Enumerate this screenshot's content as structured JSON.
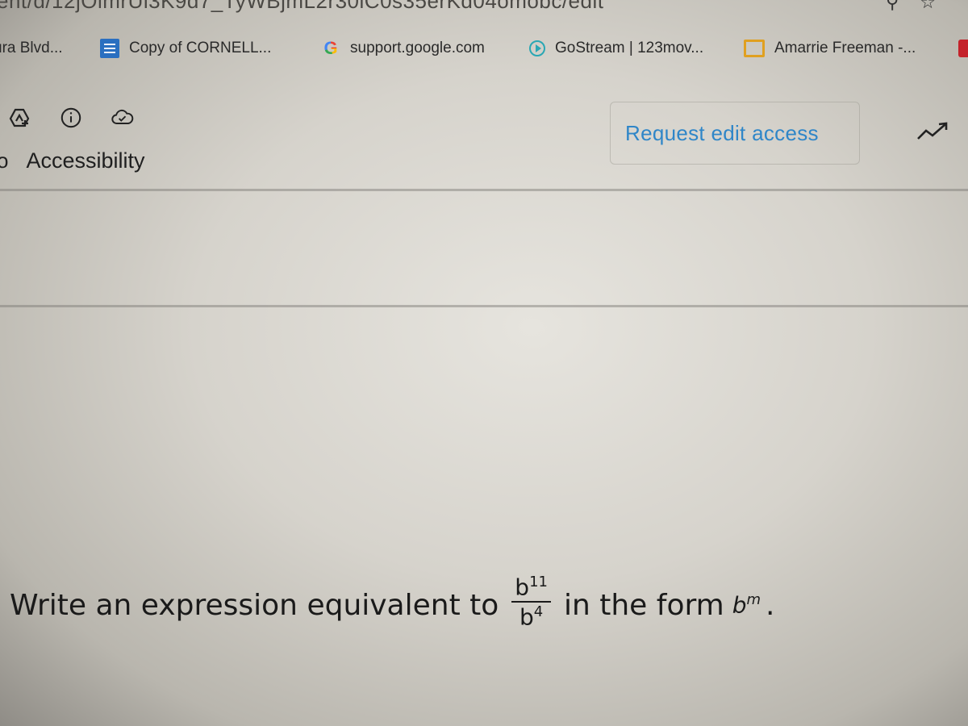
{
  "browser": {
    "url_fragment": "ent/d/12jOlmrUl3K9d7_TyWBjmL2r30lC0s35erKd04omobc/edit",
    "url_icons": [
      "zoom-icon",
      "star-icon"
    ]
  },
  "bookmarks": [
    {
      "label": "ura Blvd...",
      "icon": "none"
    },
    {
      "label": "Copy of CORNELL...",
      "icon": "docs-icon"
    },
    {
      "label": "support.google.com",
      "icon": "google-icon"
    },
    {
      "label": "GoStream | 123mov...",
      "icon": "play-icon"
    },
    {
      "label": "Amarrie Freeman -...",
      "icon": "slides-icon"
    },
    {
      "label": "",
      "icon": "youtube-icon"
    }
  ],
  "toolbar": {
    "icons": [
      "add-to-drive-icon",
      "info-icon",
      "cloud-saved-icon"
    ],
    "menu_item": "Accessibility",
    "request_button": "Request edit access",
    "trend_icon": "activity-trend-icon",
    "accent_color": "#2f86c8"
  },
  "question": {
    "prefix": "Write an expression equivalent to",
    "fraction": {
      "numerator_base": "b",
      "numerator_exp": "11",
      "denominator_base": "b",
      "denominator_exp": "4"
    },
    "middle": "in the form",
    "form_base": "b",
    "form_exp": "m",
    "suffix": "."
  }
}
